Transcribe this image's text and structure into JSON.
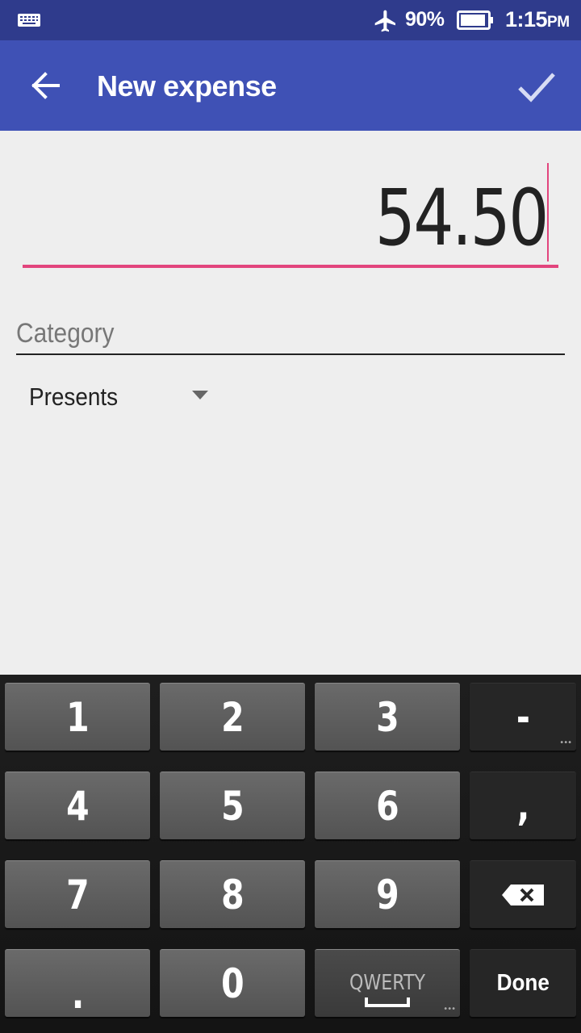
{
  "status_bar": {
    "battery_percent": "90%",
    "time": "1:15",
    "ampm": "PM",
    "icons": [
      "keyboard-icon",
      "airplane-mode-icon",
      "battery-icon"
    ]
  },
  "app_bar": {
    "title": "New expense",
    "back_icon": "arrow-back-icon",
    "confirm_icon": "check-icon",
    "color": "#3f51b5"
  },
  "amount": {
    "value": "54.50",
    "accent_color": "#e2457d"
  },
  "category": {
    "label": "Category",
    "selected": "Presents",
    "dropdown_icon": "caret-down-icon"
  },
  "keyboard": {
    "keys": {
      "k1": "1",
      "k2": "2",
      "k3": "3",
      "minus": "-",
      "k4": "4",
      "k5": "5",
      "k6": "6",
      "comma": ",",
      "k7": "7",
      "k8": "8",
      "k9": "9",
      "backspace": "backspace-icon",
      "dot": ".",
      "k0": "0",
      "qwerty": "QWERTY",
      "done": "Done"
    },
    "more_indicator": "•••"
  }
}
